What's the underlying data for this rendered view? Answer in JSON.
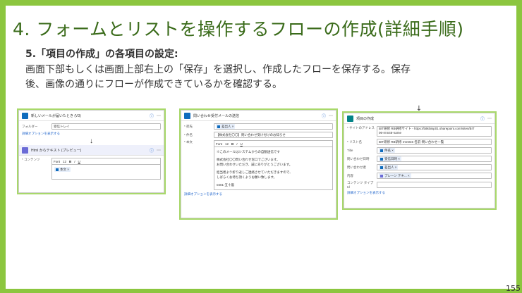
{
  "title": "4. フォームとリストを操作するフローの作成(詳細手順)",
  "subtitle": "5.「項目の作成」の各項目の設定:",
  "body_lines": [
    "画面下部もしくは画面上部右上の「保存」を選択し、作成したフローを保存する。保存",
    "後、画像の通りにフローが作成できているかを確認する。"
  ],
  "page_number": "155",
  "shot1": {
    "trigger_title": "新しいメールが届いたとき (V3)",
    "folder_label": "フォルダー",
    "folder_value": "受信トレイ",
    "advanced": "詳細オプションを表示する",
    "html_title": "Html からテキスト (プレビュー)",
    "content_label": "* コンテンツ",
    "font": "Font",
    "font_size": "12",
    "token": "本文"
  },
  "shot2": {
    "title": "問い合わせ受付メールの送信",
    "to_label": "* 宛先",
    "to_token": "差出人",
    "subject_label": "* 件名",
    "subject_value": "【株式会社〇〇】問い合わせ受け付けのお知らせ",
    "body_label": "* 本文",
    "font": "Font",
    "font_size": "12",
    "body_lines": [
      "※このメールはシステムからの自動送信です",
      "",
      "株式会社〇〇問い合わせ窓口でございます。",
      "お問い合わせいただき、誠にありがとうございます。",
      "",
      "担当者より折り返しご連絡させていただきますので、",
      "しばらくお待ち頂くようお願い致します。",
      "",
      "0401-五十嵐"
    ],
    "advanced": "詳細オプションを表示する"
  },
  "shot3": {
    "title": "項目の作成",
    "site_label": "* サイトのアドレス",
    "site_value": "BIT研修 RB研修サイト - https://bitkibisp01.sharepoint.com/sites/BIT",
    "site_sub": "06-rmn46-name",
    "list_label": "* リスト名",
    "list_value": "BIT研修 RB研修 rmn046 名前-問い合わせ一覧",
    "title_label": "Title",
    "title_token": "件名",
    "date_label": "問い合わせ日時",
    "date_token": "受信日時",
    "from_label": "問い合わせ者",
    "from_token": "差出人",
    "content_label": "内容",
    "content_token": "プレーン テキ...",
    "ctype_label": "コンテンツ タイプ Id",
    "advanced": "詳細オプションを表示する"
  }
}
